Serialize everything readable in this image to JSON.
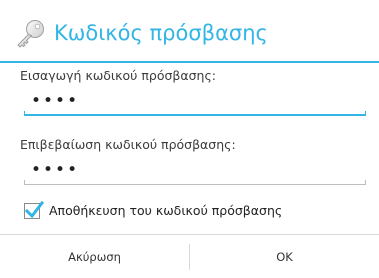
{
  "dialog": {
    "title": "Κωδικός πρόσβασης",
    "icon": "key-icon",
    "accent_color": "#33b5e5"
  },
  "password_field": {
    "label": "Εισαγωγή κωδικού πρόσβασης:",
    "value": "••••",
    "focused": true
  },
  "confirm_field": {
    "label": "Επιβεβαίωση κωδικού πρόσβασης:",
    "value": "••••",
    "focused": false
  },
  "remember": {
    "label": "Αποθήκευση του κωδικού πρόσβασης",
    "checked": true,
    "check_color": "#33b5e5"
  },
  "buttons": {
    "cancel_label": "Ακύρωση",
    "ok_label": "OK"
  }
}
